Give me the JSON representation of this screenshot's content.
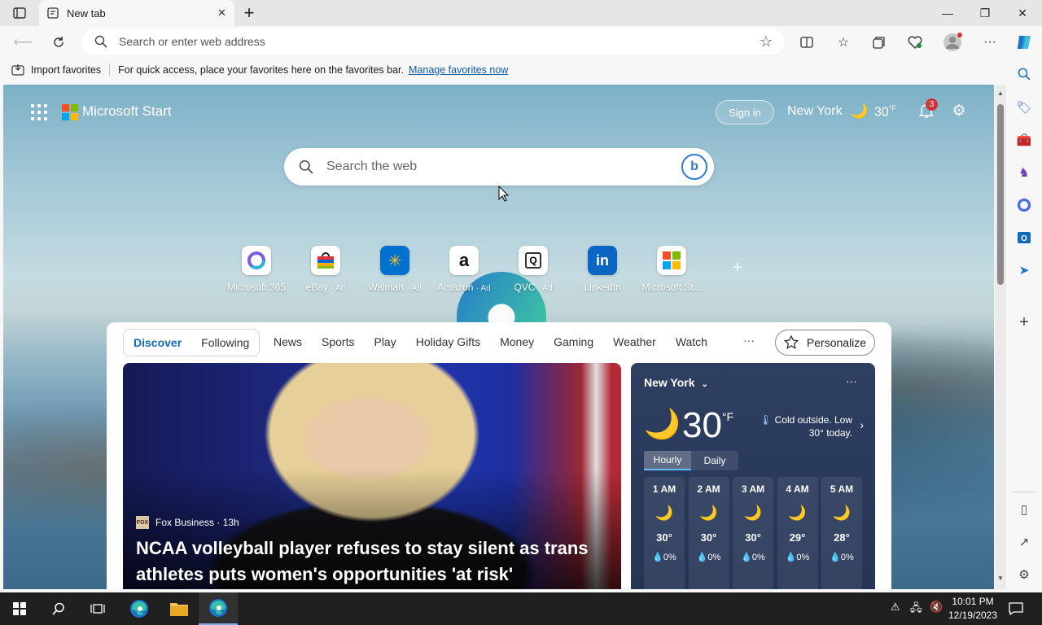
{
  "browser": {
    "tab_title": "New tab",
    "address_placeholder": "Search or enter web address"
  },
  "favorites_bar": {
    "import_label": "Import favorites",
    "message": "For quick access, place your favorites here on the favorites bar.",
    "manage_link": "Manage favorites now"
  },
  "header": {
    "brand": "Microsoft Start",
    "sign_in": "Sign in",
    "city": "New York",
    "temperature": "30",
    "unit": "°F",
    "notification_count": "3"
  },
  "search": {
    "placeholder": "Search the web"
  },
  "quick_links": [
    {
      "label": "Microsoft 365",
      "ad": ""
    },
    {
      "label": "eBay",
      "ad": "· Ad"
    },
    {
      "label": "Walmart",
      "ad": "· Ad"
    },
    {
      "label": "Amazon",
      "ad": "· Ad"
    },
    {
      "label": "QVC",
      "ad": "· Ad"
    },
    {
      "label": "LinkedIn",
      "ad": ""
    },
    {
      "label": "Microsoft St...",
      "ad": ""
    }
  ],
  "feed": {
    "tabs": [
      "Discover",
      "Following"
    ],
    "categories": [
      "News",
      "Sports",
      "Play",
      "Holiday Gifts",
      "Money",
      "Gaming",
      "Weather",
      "Watch"
    ],
    "more": "···",
    "personalize": "Personalize",
    "hero": {
      "source": "Fox Business · 13h",
      "source_logo": "FOX",
      "headline": "NCAA volleyball player refuses to stay silent as trans athletes puts women's opportunities 'at risk'"
    }
  },
  "weather": {
    "city": "New York",
    "temperature": "30",
    "unit": "°F",
    "note": "Cold outside. Low 30° today.",
    "tabs": [
      "Hourly",
      "Daily"
    ],
    "hours": [
      {
        "time": "1 AM",
        "temp": "30°",
        "precip": "0%"
      },
      {
        "time": "2 AM",
        "temp": "30°",
        "precip": "0%"
      },
      {
        "time": "3 AM",
        "temp": "30°",
        "precip": "0%"
      },
      {
        "time": "4 AM",
        "temp": "29°",
        "precip": "0%"
      },
      {
        "time": "5 AM",
        "temp": "28°",
        "precip": "0%"
      }
    ]
  },
  "taskbar": {
    "time": "10:01 PM",
    "date": "12/19/2023"
  },
  "colors": {
    "accent": "#0f6cbd",
    "moon": "#f5b733",
    "notification_badge": "#d13438"
  }
}
